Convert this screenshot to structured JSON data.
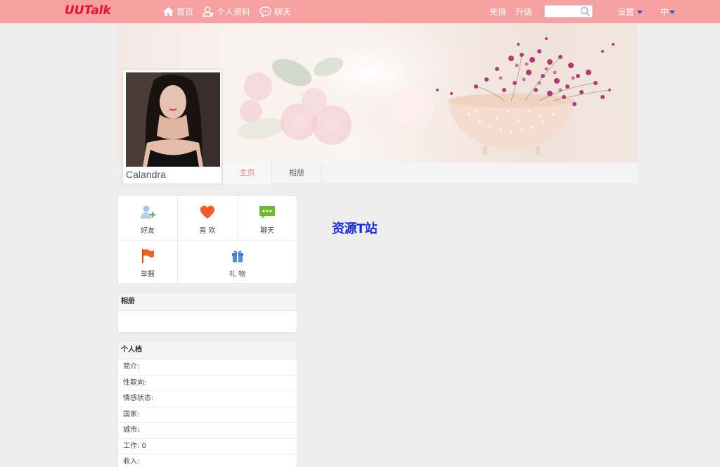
{
  "header": {
    "logo": "UUTalk",
    "nav": [
      {
        "label": "首页",
        "icon": "home-icon"
      },
      {
        "label": "个人资料",
        "icon": "profile-icon"
      },
      {
        "label": "聊天",
        "icon": "chat-icon"
      }
    ],
    "recharge": "充值",
    "upgrade": "升级",
    "search": {
      "value": "",
      "placeholder": ""
    },
    "settings": "设置",
    "language": "中"
  },
  "profile": {
    "name": "Calandra"
  },
  "tabs": [
    {
      "label": "主页",
      "active": true
    },
    {
      "label": "相册",
      "active": false
    }
  ],
  "actions": [
    {
      "label": "好友",
      "icon": "add-friend-icon"
    },
    {
      "label": "喜 欢",
      "icon": "heart-icon"
    },
    {
      "label": "聊天",
      "icon": "chat-bubble-icon"
    },
    {
      "label": "举报",
      "icon": "flag-icon"
    },
    {
      "label": "礼 物",
      "icon": "gift-icon"
    }
  ],
  "album_panel": {
    "title": "相册"
  },
  "personal_panel": {
    "title": "个人档",
    "fields": [
      {
        "label": "简介:",
        "value": ""
      },
      {
        "label": "性取向:",
        "value": ""
      },
      {
        "label": "情感状态:",
        "value": ""
      },
      {
        "label": "国家:",
        "value": ""
      },
      {
        "label": "城市:",
        "value": ""
      },
      {
        "label": "工作:",
        "value": "0"
      },
      {
        "label": "收入:",
        "value": ""
      }
    ]
  },
  "watermark": "资源T站",
  "colors": {
    "topbar": "#f7a0a2",
    "logo": "#e8102c",
    "active_tab": "#f08080",
    "watermark": "#1b29e8"
  }
}
